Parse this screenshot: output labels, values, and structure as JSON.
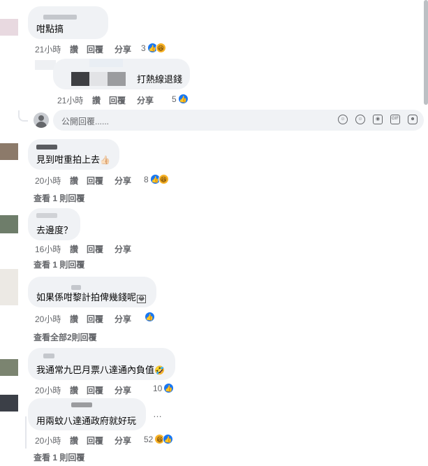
{
  "comments": [
    {
      "text": "咁點搞",
      "time": "21小時",
      "like_label": "讚",
      "reply_label": "回覆",
      "share_label": "分享",
      "reactions": "3"
    },
    {
      "text": "打熱線退錢",
      "time": "21小時",
      "like_label": "讚",
      "reply_label": "回覆",
      "share_label": "分享",
      "reactions": "5"
    },
    {
      "text": "見到咁重拍上去",
      "time": "20小時",
      "like_label": "讚",
      "reply_label": "回覆",
      "share_label": "分享",
      "reactions": "8",
      "view_replies": "查看 1 則回覆"
    },
    {
      "text": "去邊度？",
      "time": "16小時",
      "like_label": "讚",
      "reply_label": "回覆",
      "share_label": "分享",
      "view_replies": "查看 1 則回覆"
    },
    {
      "text": "如果係咁黎計拍俾幾錢呢",
      "time": "20小時",
      "like_label": "讚",
      "reply_label": "回覆",
      "share_label": "分享",
      "view_replies": "查看全部2則回覆"
    },
    {
      "text": "我通常九巴月票八達通內負值",
      "time": "20小時",
      "like_label": "讚",
      "reply_label": "回覆",
      "share_label": "分享",
      "reactions": "10"
    },
    {
      "text": "用兩蚊八達通政府就好玩",
      "time": "20小時",
      "like_label": "讚",
      "reply_label": "回覆",
      "share_label": "分享",
      "reactions": "52",
      "view_replies": "查看 1 則回覆",
      "more_label": "…"
    }
  ],
  "reply_box": {
    "placeholder": "公開回覆......"
  },
  "icons": [
    "like-icon",
    "haha-icon",
    "emoji-icon",
    "camera-icon",
    "gif-icon",
    "sticker-icon",
    "avatar-icon"
  ],
  "colors": {
    "like": "#1877f2",
    "haha": "#f7b125",
    "bubble": "#f0f2f5",
    "meta": "#65676b"
  }
}
